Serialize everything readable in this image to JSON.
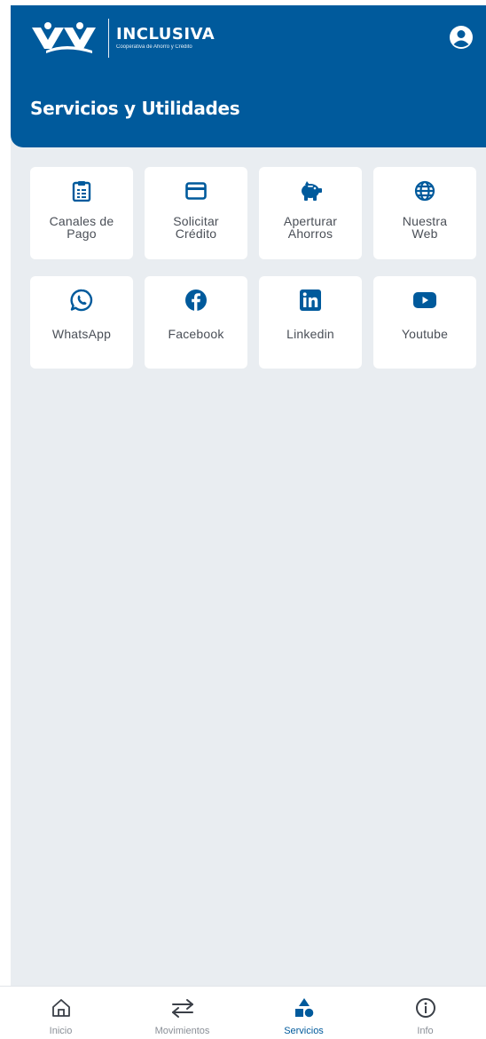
{
  "brand": {
    "name": "INCLUSIVA",
    "tagline": "Cooperativa de Ahorro y Crédito",
    "header_color": "#005a9c",
    "logo_icon": "inclusiva-logo"
  },
  "header": {
    "title": "Servicios y Utilidades",
    "profile_icon": "user-circle-icon"
  },
  "services": [
    {
      "label": "Canales de\nPago",
      "icon": "clipboard-list-icon"
    },
    {
      "label": "Solicitar\nCrédito",
      "icon": "credit-card-icon"
    },
    {
      "label": "Aperturar\nAhorros",
      "icon": "piggy-bank-icon"
    },
    {
      "label": "Nuestra\nWeb",
      "icon": "globe-icon"
    },
    {
      "label": "WhatsApp",
      "icon": "whatsapp-icon"
    },
    {
      "label": "Facebook",
      "icon": "facebook-icon"
    },
    {
      "label": "Linkedin",
      "icon": "linkedin-icon"
    },
    {
      "label": "Youtube",
      "icon": "youtube-icon"
    }
  ],
  "bottom_nav": {
    "items": [
      {
        "label": "Inicio",
        "icon": "home-icon",
        "active": false
      },
      {
        "label": "Movimientos",
        "icon": "transfer-arrows-icon",
        "active": false
      },
      {
        "label": "Servicios",
        "icon": "shapes-icon",
        "active": true
      },
      {
        "label": "Info",
        "icon": "info-icon",
        "active": false
      }
    ],
    "active_color": "#005a9c",
    "inactive_color": "#8a8f97"
  }
}
